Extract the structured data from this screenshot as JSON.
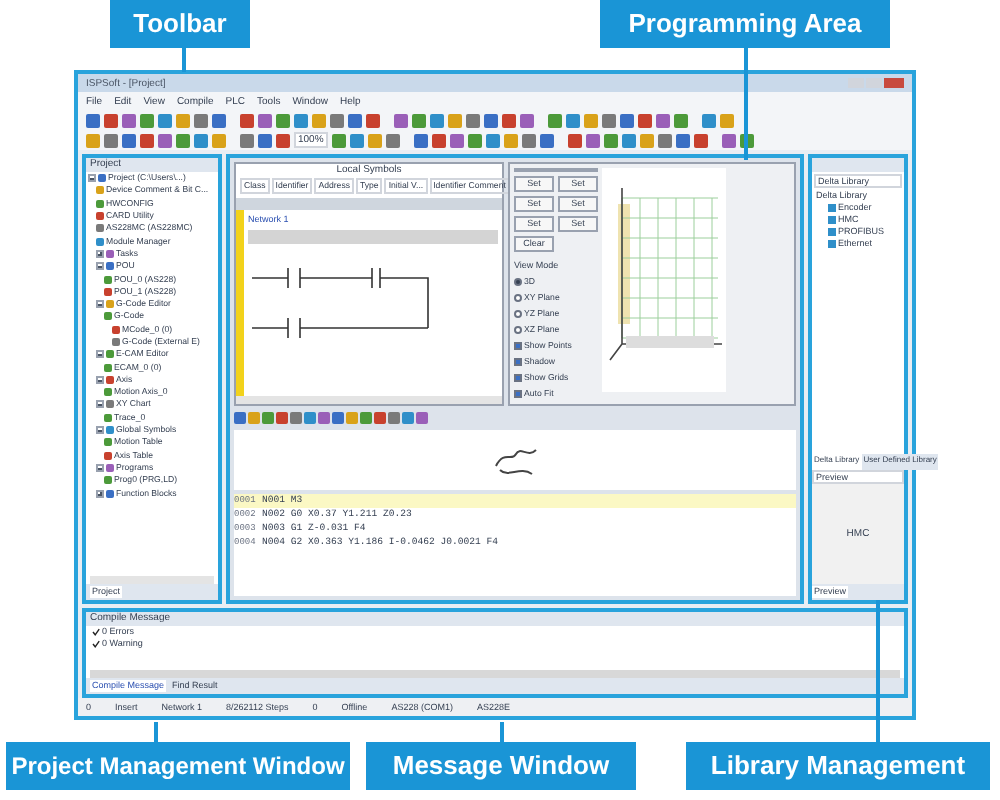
{
  "callouts": [
    {
      "label": "Toolbar"
    },
    {
      "label": "Programming Area"
    },
    {
      "label": "Project Management Window"
    },
    {
      "label": "Message Window"
    },
    {
      "label": "Library Management"
    }
  ],
  "window": {
    "title": "ISPSoft - [Project]"
  },
  "menu": [
    "File",
    "Edit",
    "View",
    "Compile",
    "PLC",
    "Tools",
    "Window",
    "Help"
  ],
  "zoom": "100%",
  "project": {
    "title": "Project",
    "tab": "Project",
    "tree": [
      {
        "label": "Project (C:\\Users\\...)",
        "expanded": true,
        "children": [
          {
            "label": "Device Comment & Bit C..."
          },
          {
            "label": "HWCONFIG"
          },
          {
            "label": "CARD Utility"
          },
          {
            "label": "AS228MC (AS228MC)"
          },
          {
            "label": "Module Manager"
          },
          {
            "label": "Tasks",
            "expanded": false
          },
          {
            "label": "POU",
            "expanded": true,
            "children": [
              {
                "label": "POU_0 (AS228)"
              },
              {
                "label": "POU_1 (AS228)"
              }
            ]
          },
          {
            "label": "G-Code Editor",
            "expanded": true,
            "children": [
              {
                "label": "G-Code",
                "children": [
                  {
                    "label": "MCode_0 (0)"
                  },
                  {
                    "label": "G-Code (External E)"
                  }
                ]
              }
            ]
          },
          {
            "label": "E-CAM Editor",
            "expanded": true,
            "children": [
              {
                "label": "ECAM_0 (0)"
              }
            ]
          },
          {
            "label": "Axis",
            "expanded": true,
            "children": [
              {
                "label": "Motion Axis_0"
              }
            ]
          },
          {
            "label": "XY Chart",
            "expanded": true,
            "children": [
              {
                "label": "Trace_0"
              }
            ]
          },
          {
            "label": "Global Symbols",
            "expanded": true,
            "children": [
              {
                "label": "Motion Table"
              },
              {
                "label": "Axis Table"
              }
            ]
          },
          {
            "label": "Programs",
            "expanded": true,
            "children": [
              {
                "label": "Prog0 (PRG,LD)"
              }
            ]
          },
          {
            "label": "Function Blocks",
            "expanded": false
          }
        ]
      }
    ]
  },
  "editor": {
    "title": "Local Symbols",
    "columns": [
      "Class",
      "Identifier",
      "Address",
      "Type",
      "Initial V...",
      "Identifier Comment"
    ],
    "network": "Network 1"
  },
  "chart_panel": {
    "buttons": [
      "Set",
      "Set",
      "Set",
      "Set",
      "Set",
      "Set",
      "Clear"
    ],
    "view_mode": "View Mode",
    "modes": [
      {
        "label": "3D",
        "selected": true
      },
      {
        "label": "XY Plane",
        "selected": false
      },
      {
        "label": "YZ Plane",
        "selected": false
      },
      {
        "label": "XZ Plane",
        "selected": false
      }
    ],
    "options": [
      {
        "label": "Show Points",
        "checked": true
      },
      {
        "label": "Shadow",
        "checked": true
      },
      {
        "label": "Show Grids",
        "checked": true
      },
      {
        "label": "Auto Fit",
        "checked": true
      }
    ]
  },
  "gcode": {
    "lines": [
      {
        "number": "0001",
        "text": "N001 M3",
        "selected": true
      },
      {
        "number": "0002",
        "text": "N002 G0 X0.37 Y1.211 Z0.23",
        "selected": false
      },
      {
        "number": "0003",
        "text": "N003 G1 Z-0.031 F4",
        "selected": false
      },
      {
        "number": "0004",
        "text": "N004 G2 X0.363 Y1.186 I-0.0462 J0.0021 F4",
        "selected": false
      }
    ]
  },
  "library": {
    "dropdown": "Delta Library",
    "tree": [
      {
        "label": "Delta Library",
        "children": [
          {
            "label": "Encoder"
          },
          {
            "label": "HMC"
          },
          {
            "label": "PROFIBUS"
          },
          {
            "label": "Ethernet"
          }
        ]
      }
    ],
    "tabs": [
      {
        "label": "Delta Library",
        "selected": true
      },
      {
        "label": "User Defined Library",
        "selected": false
      }
    ],
    "preview_dropdown": "Preview",
    "preview": "HMC",
    "bottom_tab": "Preview"
  },
  "messages": {
    "title": "Compile Message",
    "lines": [
      "0 Errors",
      "0 Warning"
    ],
    "tabs": [
      {
        "label": "Compile Message",
        "selected": true
      },
      {
        "label": "Find Result",
        "selected": false
      }
    ]
  },
  "status_bar": [
    "0",
    "Insert",
    "Network 1",
    "8/262112 Steps",
    "0",
    "Offline",
    "AS228 (COM1)",
    "AS228E"
  ]
}
